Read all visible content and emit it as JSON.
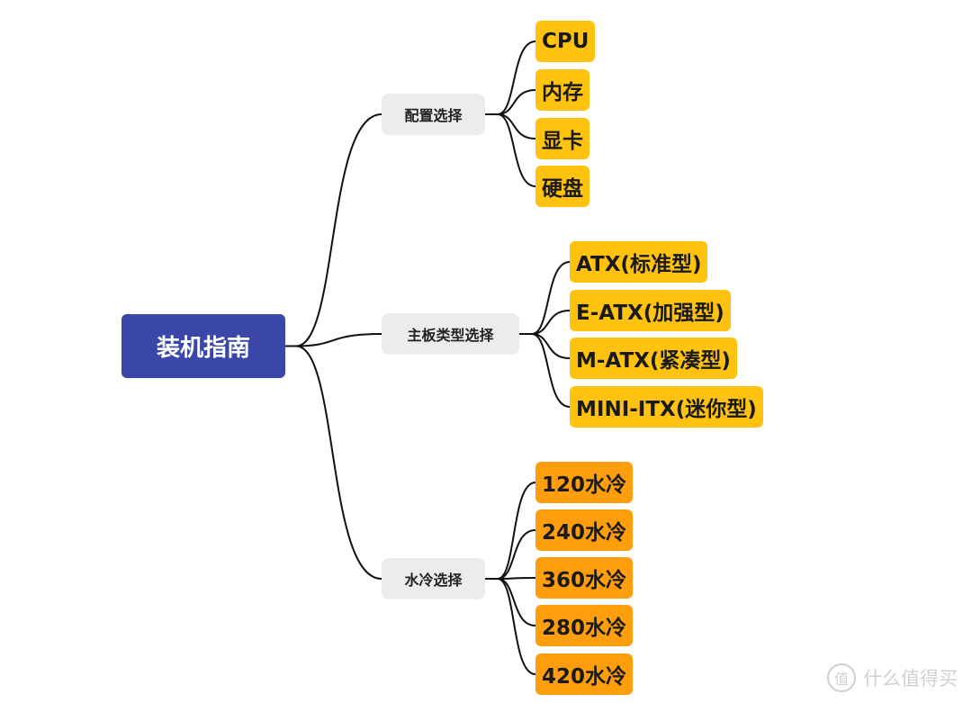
{
  "root": {
    "label": "装机指南",
    "color": "#3a47a8"
  },
  "branches": [
    {
      "label": "配置选择",
      "children": [
        "CPU",
        "内存",
        "显卡",
        "硬盘"
      ]
    },
    {
      "label": "主板类型选择",
      "children": [
        "ATX(标准型)",
        "E-ATX(加强型)",
        "M-ATX(紧凑型)",
        "MINI-ITX(迷你型)"
      ]
    },
    {
      "label": "水冷选择",
      "children": [
        "120水冷",
        "240水冷",
        "360水冷",
        "280水冷",
        "420水冷"
      ]
    }
  ],
  "colors": {
    "leaf_yellow": "#ffc20e",
    "leaf_orange": "#ff9e0c",
    "branch_bg": "#ececec",
    "line": "#111111"
  },
  "watermark": {
    "badge": "值",
    "text": "什么值得买"
  }
}
